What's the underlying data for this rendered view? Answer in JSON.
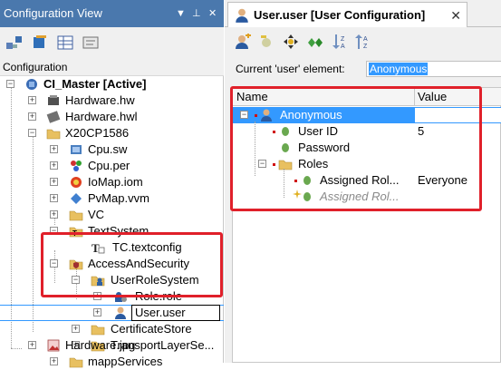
{
  "left_panel": {
    "title": "Configuration View",
    "controls": [
      "▼",
      "⊥",
      "✕"
    ],
    "label": "Configuration",
    "tree": [
      {
        "label": "CI_Master [Active]",
        "bold": true
      },
      {
        "label": "Hardware.hw"
      },
      {
        "label": "Hardware.hwl"
      },
      {
        "label": "X20CP1586"
      },
      {
        "label": "Cpu.sw"
      },
      {
        "label": "Cpu.per"
      },
      {
        "label": "IoMap.iom"
      },
      {
        "label": "PvMap.vvm"
      },
      {
        "label": "VC"
      },
      {
        "label": "TextSystem"
      },
      {
        "label": "TC.textconfig"
      },
      {
        "label": "AccessAndSecurity"
      },
      {
        "label": "UserRoleSystem"
      },
      {
        "label": "Role.role"
      },
      {
        "label": "User.user"
      },
      {
        "label": "CertificateStore"
      },
      {
        "label": "TransportLayerSe..."
      },
      {
        "label": "mappServices"
      },
      {
        "label": "Hardware.jpg"
      }
    ]
  },
  "editor": {
    "tab_label": "User.user [User Configuration]",
    "tab_close": "✕",
    "current_label": "Current 'user' element:",
    "current_value": "Anonymous",
    "grid": {
      "columns": [
        "Name",
        "Value"
      ],
      "rows": [
        {
          "name": "Anonymous",
          "value": ""
        },
        {
          "name": "User ID",
          "value": "5"
        },
        {
          "name": "Password",
          "value": ""
        },
        {
          "name": "Roles",
          "value": ""
        },
        {
          "name": "Assigned Rol...",
          "value": "Everyone"
        },
        {
          "name": "Assigned Rol...",
          "value": ""
        }
      ]
    }
  },
  "colors": {
    "accent": "#4a78ad",
    "selection": "#3399ff",
    "highlight_box": "#e0202a"
  }
}
